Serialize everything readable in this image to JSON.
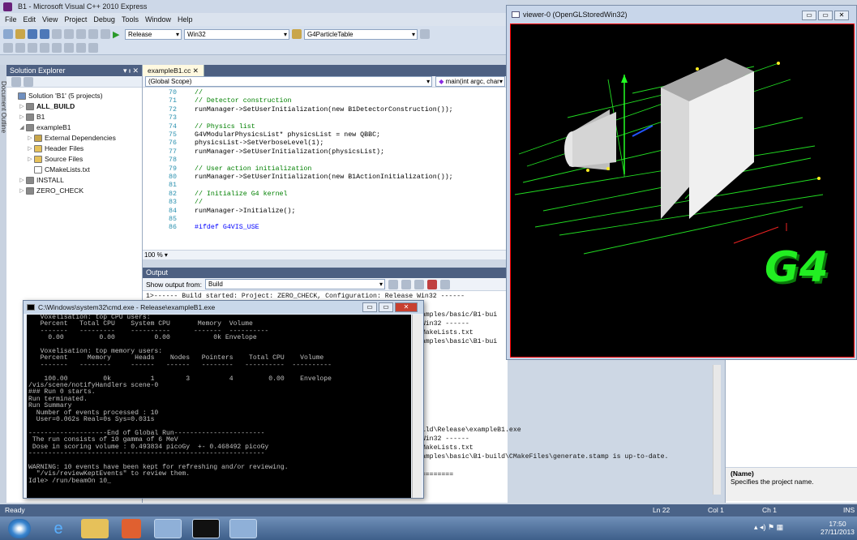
{
  "vs": {
    "title": "B1 - Microsoft Visual C++ 2010 Express",
    "menu": [
      "File",
      "Edit",
      "View",
      "Project",
      "Debug",
      "Tools",
      "Window",
      "Help"
    ],
    "config": "Release",
    "platform": "Win32",
    "find": "G4ParticleTable"
  },
  "solution_explorer": {
    "title": "Solution Explorer",
    "pin": "▾ ᵻ ✕",
    "side_tab": "Document Outline",
    "items": [
      {
        "label": "Solution 'B1' (5 projects)",
        "bold": false
      },
      {
        "label": "ALL_BUILD",
        "bold": true
      },
      {
        "label": "B1",
        "bold": false
      },
      {
        "label": "exampleB1",
        "bold": false
      },
      {
        "label": "External Dependencies",
        "bold": false
      },
      {
        "label": "Header Files",
        "bold": false
      },
      {
        "label": "Source Files",
        "bold": false
      },
      {
        "label": "CMakeLists.txt",
        "bold": false
      },
      {
        "label": "INSTALL",
        "bold": false
      },
      {
        "label": "ZERO_CHECK",
        "bold": false
      }
    ]
  },
  "editor": {
    "tab": "exampleB1.cc",
    "tab_close": "✕",
    "scope": "(Global Scope)",
    "member": "main(int argc, char",
    "zoom": "100 %",
    "lines": [
      {
        "n": "70",
        "t": "//",
        "c": "cmt"
      },
      {
        "n": "71",
        "t": "// Detector construction",
        "c": "cmt"
      },
      {
        "n": "72",
        "t": "runManager->SetUserInitialization(new B1DetectorConstruction());",
        "c": ""
      },
      {
        "n": "73",
        "t": "",
        "c": ""
      },
      {
        "n": "74",
        "t": "// Physics list",
        "c": "cmt"
      },
      {
        "n": "75",
        "t": "G4VModularPhysicsList* physicsList = new QBBC;",
        "c": ""
      },
      {
        "n": "76",
        "t": "physicsList->SetVerboseLevel(1);",
        "c": ""
      },
      {
        "n": "77",
        "t": "runManager->SetUserInitialization(physicsList);",
        "c": ""
      },
      {
        "n": "78",
        "t": "",
        "c": ""
      },
      {
        "n": "79",
        "t": "// User action initialization",
        "c": "cmt"
      },
      {
        "n": "80",
        "t": "runManager->SetUserInitialization(new B1ActionInitialization());",
        "c": ""
      },
      {
        "n": "81",
        "t": "",
        "c": ""
      },
      {
        "n": "82",
        "t": "// Initialize G4 kernel",
        "c": "cmt"
      },
      {
        "n": "83",
        "t": "//",
        "c": "cmt"
      },
      {
        "n": "84",
        "t": "runManager->Initialize();",
        "c": ""
      },
      {
        "n": "85",
        "t": "",
        "c": ""
      },
      {
        "n": "86",
        "t": "#ifdef G4VIS_USE",
        "c": "kw"
      }
    ]
  },
  "output": {
    "title": "Output",
    "show_from_label": "Show output from:",
    "show_from": "Build",
    "first_line": "1>------ Build started: Project: ZERO_CHECK, Configuration: Release Win32 ------",
    "right_lines": [
      "examples/basic/B1-bui",
      "e Win32 ------",
      "/CMakeLists.txt",
      "examples\\basic\\B1-bui"
    ],
    "right_lines_2": [
      "build\\Release\\exampleB1.exe",
      "e Win32 ------",
      "/CMakeLists.txt",
      "examples\\basic\\B1-build\\CMakeFiles\\generate.stamp is up-to-date.",
      "",
      "=========="
    ]
  },
  "viewer": {
    "title": "viewer-0 (OpenGLStoredWin32)",
    "logo": "G4"
  },
  "properties": {
    "name_label": "(Name)",
    "desc": "Specifies the project name."
  },
  "cmd": {
    "title": "C:\\Windows\\system32\\cmd.exe - Release\\exampleB1.exe",
    "text": "   Voxelisation: top CPU users:\n   Percent   Total CPU    System CPU       Memory  Volume\n   -------   ---------    ----------      -------  ----------\n     0.00         0.00          0.00           0k Envelope\n\n   Voxelisation: top memory users:\n   Percent     Memory      Heads    Nodes   Pointers    Total CPU    Volume\n   -------   --------     ------   ------   --------   ----------  ----------\n\n    100.00         0k          1        3          4         0.00    Envelope\n/vis/scene/notifyHandlers scene-0\n### Run 0 starts.\nRun terminated.\nRun Summary\n  Number of events processed : 10\n  User=0.062s Real=0s Sys=0.031s\n\n--------------------End of Global Run-----------------------\n The run consists of 10 gamma of 6 MeV\n Dose in scoring volume : 0.493834 picoGy  +- 0.468492 picoGy\n------------------------------------------------------------\n\nWARNING: 10 events have been kept for refreshing and/or reviewing.\n  \"/vis/reviewKeptEvents\" to review them.\nIdle> /run/beamOn 10_"
  },
  "status": {
    "left": "Ready",
    "ln": "Ln 22",
    "col": "Col 1",
    "ch": "Ch 1",
    "mode": "INS"
  },
  "taskbar": {
    "time": "17:50",
    "date": "27/11/2013"
  }
}
